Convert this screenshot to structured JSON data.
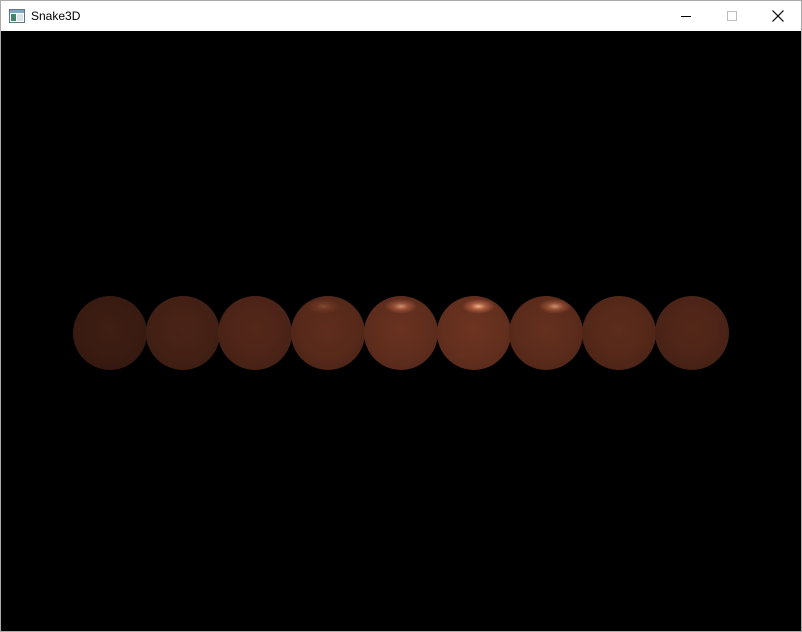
{
  "window": {
    "title": "Snake3D",
    "icon": "app-window-icon",
    "controls": [
      "minimize-icon",
      "maximize-icon",
      "close-icon"
    ]
  },
  "scene": {
    "background": "#000000",
    "snake_color": "#7a3a22",
    "segment_count": 9,
    "segments": [
      {
        "index": 1,
        "brightness": 0.3,
        "highlight": 0.0
      },
      {
        "index": 2,
        "brightness": 0.35,
        "highlight": 0.0
      },
      {
        "index": 3,
        "brightness": 0.4,
        "highlight": 0.0
      },
      {
        "index": 4,
        "brightness": 0.45,
        "highlight": 0.25
      },
      {
        "index": 5,
        "brightness": 0.5,
        "highlight": 0.75
      },
      {
        "index": 6,
        "brightness": 0.52,
        "highlight": 1.0
      },
      {
        "index": 7,
        "brightness": 0.48,
        "highlight": 0.75
      },
      {
        "index": 8,
        "brightness": 0.44,
        "highlight": 0.0
      },
      {
        "index": 9,
        "brightness": 0.4,
        "highlight": 0.0
      }
    ]
  }
}
